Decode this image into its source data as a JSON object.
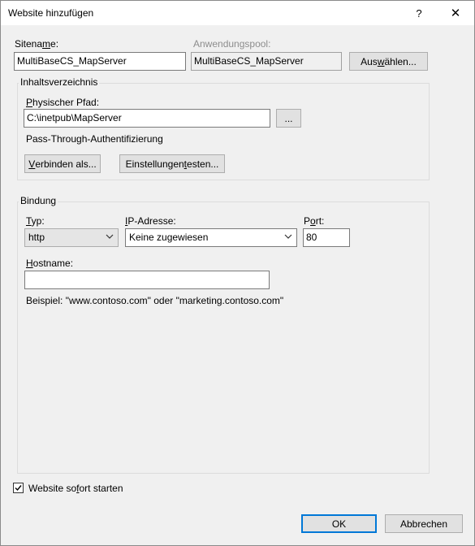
{
  "window": {
    "title": "Website hinzufügen",
    "help_glyph": "?",
    "close_glyph": "✕"
  },
  "site": {
    "name_label_pre": "Sitena",
    "name_label_acc": "m",
    "name_label_post": "e:",
    "name_value": "MultiBaseCS_MapServer"
  },
  "app_pool": {
    "label_pre": "Anwendun",
    "label_acc": "g",
    "label_post": "spool:",
    "value": "MultiBaseCS_MapServer",
    "select_pre": "Aus",
    "select_acc": "w",
    "select_post": "ählen..."
  },
  "content_dir": {
    "group_title": "Inhaltsverzeichnis",
    "path_label_acc": "P",
    "path_label_post": "hysischer Pfad:",
    "path_value": "C:\\inetpub\\MapServer",
    "browse_label": "...",
    "auth_text": "Pass-Through-Authentifizierung",
    "connect_pre": "",
    "connect_acc": "V",
    "connect_post": "erbinden als...",
    "test_pre": "Einstellungen ",
    "test_acc": "t",
    "test_post": "esten..."
  },
  "binding": {
    "group_title": "Bindung",
    "type_label_acc": "T",
    "type_label_post": "yp:",
    "type_value": "http",
    "ip_label_acc": "I",
    "ip_label_post": "P-Adresse:",
    "ip_value": "Keine zugewiesen",
    "port_label_pre": "P",
    "port_label_acc": "o",
    "port_label_post": "rt:",
    "port_value": "80",
    "hostname_label_acc": "H",
    "hostname_label_post": "ostname:",
    "hostname_value": "",
    "example_text": "Beispiel: \"www.contoso.com\" oder \"marketing.contoso.com\""
  },
  "start": {
    "checked": true,
    "label_pre": "Website so",
    "label_acc": "f",
    "label_post": "ort starten"
  },
  "footer": {
    "ok_label": "OK",
    "cancel_label": "Abbrechen"
  }
}
